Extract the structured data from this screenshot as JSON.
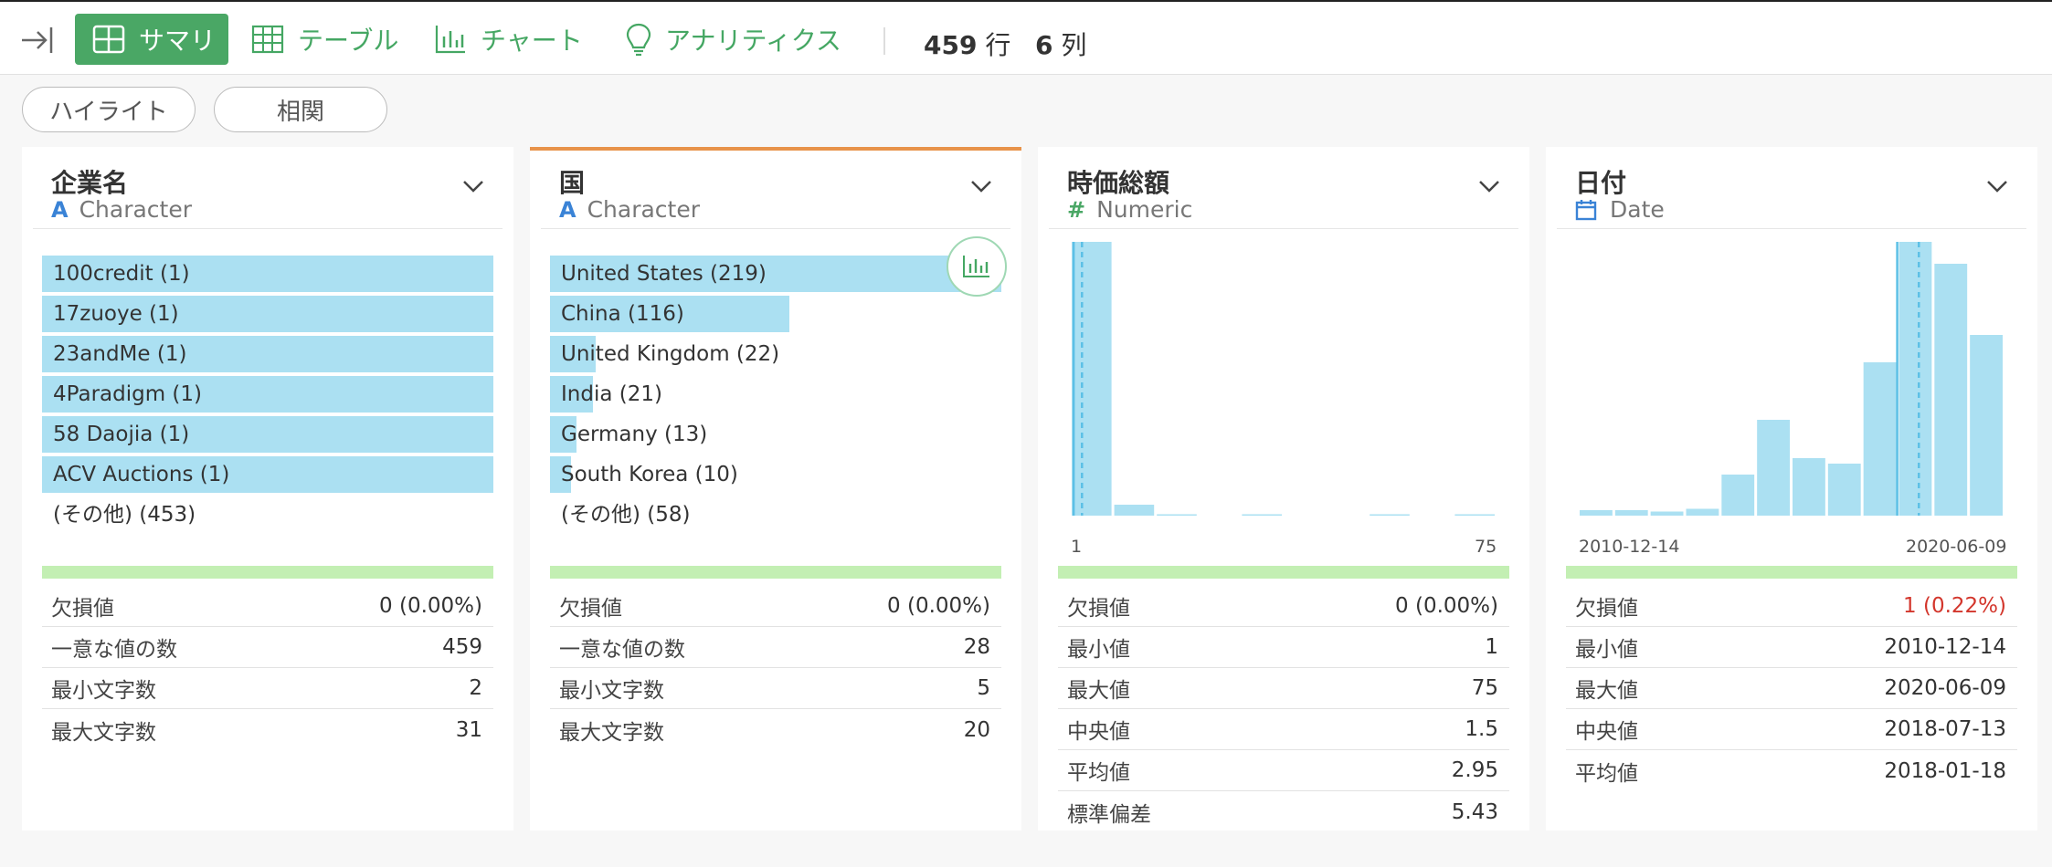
{
  "toolbar": {
    "tabs": [
      {
        "label": "サマリ",
        "icon": "summary-grid-icon",
        "active": true
      },
      {
        "label": "テーブル",
        "icon": "table-icon",
        "active": false
      },
      {
        "label": "チャート",
        "icon": "bar-chart-icon",
        "active": false
      },
      {
        "label": "アナリティクス",
        "icon": "lightbulb-icon",
        "active": false
      }
    ],
    "rows_count": "459",
    "rows_unit": "行",
    "cols_count": "6",
    "cols_unit": "列"
  },
  "pills": [
    "ハイライト",
    "相関"
  ],
  "colors": {
    "accent": "#4aa765",
    "bar": "#abe0f2",
    "selected_border": "#e8934a",
    "missing_bar": "#c3efb3",
    "warning": "#d3362c"
  },
  "columns": [
    {
      "name": "企業名",
      "type": "Character",
      "type_icon": "A",
      "categories": [
        {
          "label": "100credit (1)",
          "count": 1
        },
        {
          "label": "17zuoye (1)",
          "count": 1
        },
        {
          "label": "23andMe (1)",
          "count": 1
        },
        {
          "label": "4Paradigm (1)",
          "count": 1
        },
        {
          "label": "58 Daojia (1)",
          "count": 1
        },
        {
          "label": "ACV Auctions (1)",
          "count": 1
        }
      ],
      "other": "(その他) (453)",
      "stats": [
        {
          "label": "欠損値",
          "value": "0 (0.00%)"
        },
        {
          "label": "一意な値の数",
          "value": "459"
        },
        {
          "label": "最小文字数",
          "value": "2"
        },
        {
          "label": "最大文字数",
          "value": "31"
        }
      ]
    },
    {
      "name": "国",
      "type": "Character",
      "type_icon": "A",
      "categories": [
        {
          "label": "United States (219)",
          "count": 219
        },
        {
          "label": "China (116)",
          "count": 116
        },
        {
          "label": "United Kingdom (22)",
          "count": 22
        },
        {
          "label": "India (21)",
          "count": 21
        },
        {
          "label": "Germany (13)",
          "count": 13
        },
        {
          "label": "South Korea (10)",
          "count": 10
        }
      ],
      "other": "(その他) (58)",
      "stats": [
        {
          "label": "欠損値",
          "value": "0 (0.00%)"
        },
        {
          "label": "一意な値の数",
          "value": "28"
        },
        {
          "label": "最小文字数",
          "value": "5"
        },
        {
          "label": "最大文字数",
          "value": "20"
        }
      ]
    },
    {
      "name": "時価総額",
      "type": "Numeric",
      "type_icon": "#",
      "hist_min": "1",
      "hist_max": "75",
      "stats": [
        {
          "label": "欠損値",
          "value": "0 (0.00%)"
        },
        {
          "label": "最小値",
          "value": "1"
        },
        {
          "label": "最大値",
          "value": "75"
        },
        {
          "label": "中央値",
          "value": "1.5"
        },
        {
          "label": "平均値",
          "value": "2.95"
        },
        {
          "label": "標準偏差",
          "value": "5.43"
        }
      ]
    },
    {
      "name": "日付",
      "type": "Date",
      "type_icon": "calendar-icon",
      "hist_min": "2010-12-14",
      "hist_max": "2020-06-09",
      "stats": [
        {
          "label": "欠損値",
          "value": "1 (0.22%)",
          "warning": true
        },
        {
          "label": "最小値",
          "value": "2010-12-14"
        },
        {
          "label": "最大値",
          "value": "2020-06-09"
        },
        {
          "label": "中央値",
          "value": "2018-07-13"
        },
        {
          "label": "平均値",
          "value": "2018-01-18"
        }
      ]
    }
  ],
  "chart_data": [
    {
      "type": "bar",
      "title": "時価総額",
      "x_range": [
        1,
        75
      ],
      "values": [
        100,
        4,
        0.5,
        0,
        0.4,
        0,
        0,
        0.4,
        0,
        0.5
      ],
      "median": 1.5,
      "mean": 2.95
    },
    {
      "type": "bar",
      "title": "日付",
      "x_range": [
        "2010-12-14",
        "2020-06-09"
      ],
      "values": [
        2,
        2,
        1.5,
        2.5,
        15,
        35,
        21,
        19,
        56,
        100,
        92,
        66
      ],
      "median": "2018-07-13",
      "mean": "2018-01-18"
    }
  ]
}
